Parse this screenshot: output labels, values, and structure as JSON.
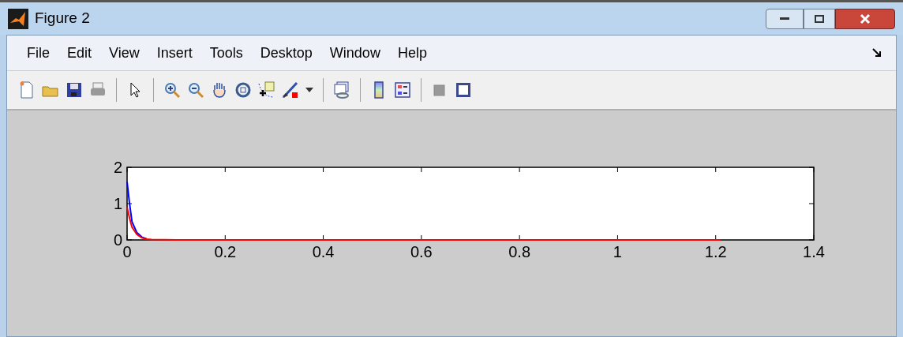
{
  "window": {
    "title": "Figure 2"
  },
  "menu": [
    {
      "label": "File"
    },
    {
      "label": "Edit"
    },
    {
      "label": "View"
    },
    {
      "label": "Insert"
    },
    {
      "label": "Tools"
    },
    {
      "label": "Desktop"
    },
    {
      "label": "Window"
    },
    {
      "label": "Help"
    }
  ],
  "axes": {
    "chart_data": {
      "type": "line",
      "x": [
        0,
        0.005,
        0.01,
        0.02,
        0.03,
        0.04,
        0.05,
        0.1,
        0.4,
        0.8,
        1.21
      ],
      "series": [
        {
          "color": "#0000ff",
          "values": [
            1.6,
            1.0,
            0.5,
            0.2,
            0.08,
            0.03,
            null,
            null,
            null,
            null,
            null
          ]
        },
        {
          "color": "#ff0000",
          "values": [
            0.9,
            0.6,
            0.35,
            0.15,
            0.06,
            0.02,
            0.01,
            0,
            0,
            0,
            0
          ]
        }
      ],
      "xlim": [
        0,
        1.4
      ],
      "ylim": [
        0,
        2
      ],
      "xticks": [
        0,
        0.2,
        0.4,
        0.6,
        0.8,
        1,
        1.2,
        1.4
      ],
      "yticks": [
        0,
        1,
        2
      ]
    }
  }
}
